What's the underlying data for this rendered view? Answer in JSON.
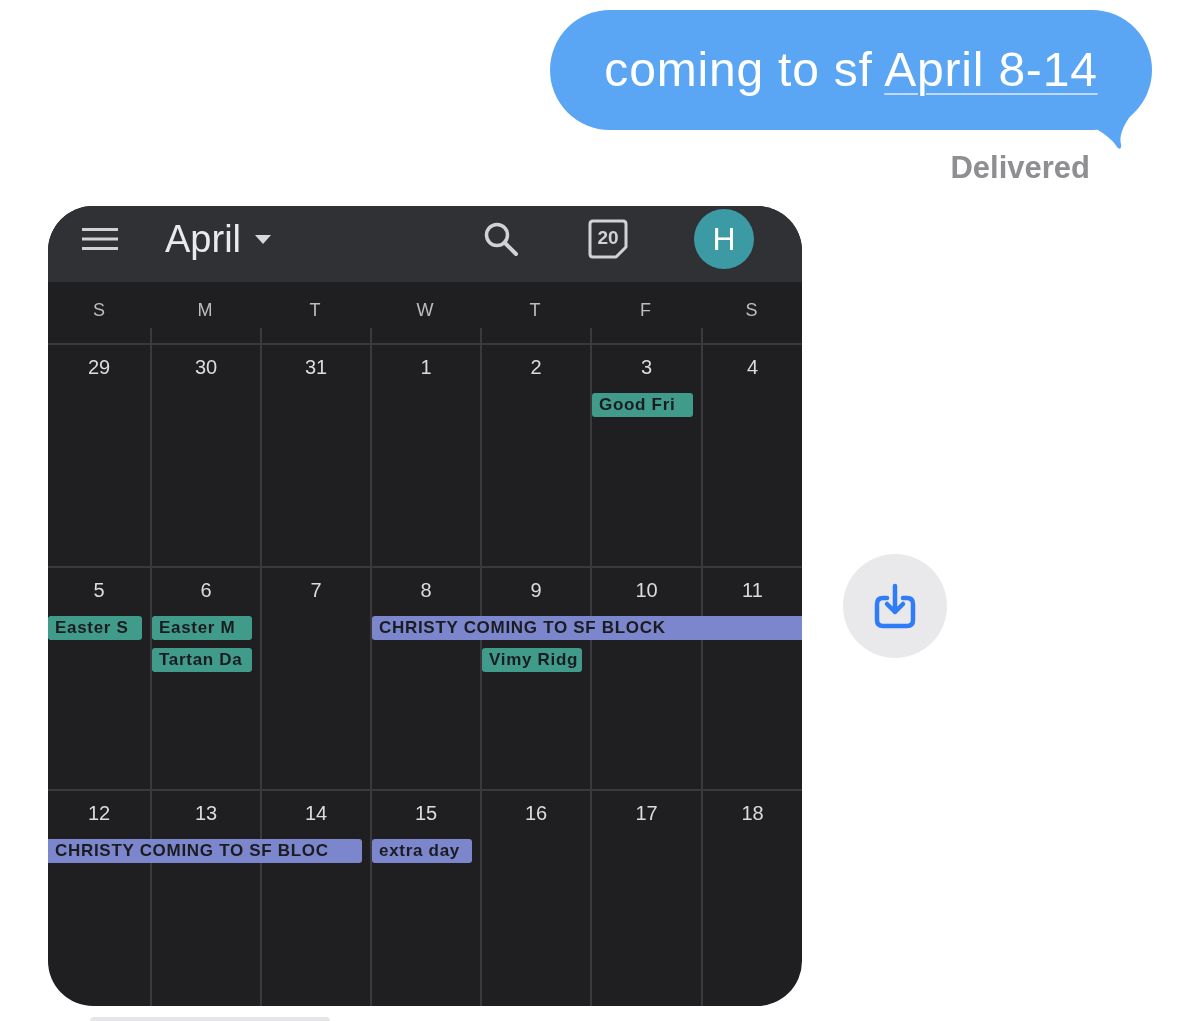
{
  "message": {
    "text": "coming to sf",
    "link": "April 8-14",
    "status": "Delivered"
  },
  "calendar": {
    "month": "April",
    "today": "20",
    "avatar": "H",
    "weekdays": [
      "S",
      "M",
      "T",
      "W",
      "T",
      "F",
      "S"
    ],
    "weeks": [
      {
        "days": [
          {
            "date": "29"
          },
          {
            "date": "30"
          },
          {
            "date": "31"
          },
          {
            "date": "1"
          },
          {
            "date": "2"
          },
          {
            "date": "3",
            "slots": [
              {
                "kind": "event",
                "text": "Good Fri",
                "color": "#409b8b",
                "continues_before": false,
                "continues_after": false
              }
            ]
          },
          {
            "date": "4"
          }
        ]
      },
      {
        "days": [
          {
            "date": "5",
            "slots": [
              {
                "kind": "event",
                "text": "Easter S",
                "color": "#409b8b",
                "continues_before": false,
                "continues_after": false
              }
            ]
          },
          {
            "date": "6",
            "slots": [
              {
                "kind": "event",
                "text": "Easter M",
                "color": "#409b8b",
                "continues_before": false,
                "continues_after": false
              },
              {
                "kind": "event",
                "text": "Tartan Da",
                "color": "#409b8b",
                "continues_before": false,
                "continues_after": false
              }
            ]
          },
          {
            "date": "7"
          },
          {
            "date": "8",
            "slots": [
              {
                "kind": "event",
                "text": "CHRISTY COMING TO SF BLOCK",
                "color": "#7c86cc",
                "continues_before": false,
                "continues_after": true
              }
            ]
          },
          {
            "date": "9",
            "slots": [
              {
                "kind": "extend"
              },
              {
                "kind": "event",
                "text": "Vimy Ridg",
                "color": "#409b8b",
                "continues_before": false,
                "continues_after": false
              }
            ]
          },
          {
            "date": "10",
            "slots": [
              {
                "kind": "extend"
              }
            ]
          },
          {
            "date": "11",
            "slots": [
              {
                "kind": "extend"
              }
            ]
          }
        ]
      },
      {
        "days": [
          {
            "date": "12",
            "slots": [
              {
                "kind": "event",
                "text": "CHRISTY COMING TO SF BLOC",
                "color": "#7c86cc",
                "continues_before": true,
                "continues_after": false
              }
            ]
          },
          {
            "date": "13",
            "slots": [
              {
                "kind": "extend"
              }
            ]
          },
          {
            "date": "14",
            "slots": [
              {
                "kind": "extend"
              }
            ]
          },
          {
            "date": "15",
            "slots": [
              {
                "kind": "event",
                "text": "extra day",
                "color": "#7c86cc",
                "continues_before": false,
                "continues_after": false
              }
            ]
          },
          {
            "date": "16"
          },
          {
            "date": "17"
          },
          {
            "date": "18"
          }
        ]
      }
    ]
  }
}
